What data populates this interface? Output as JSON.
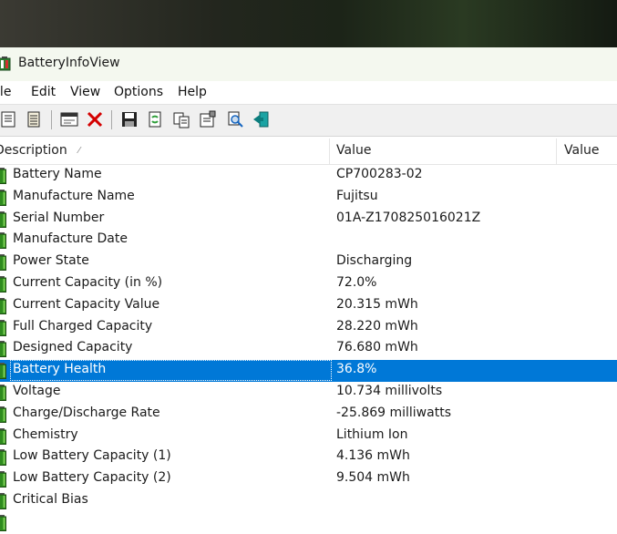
{
  "window": {
    "title": "BatteryInfoView"
  },
  "menu": [
    "File",
    "Edit",
    "View",
    "Options",
    "Help"
  ],
  "toolbar": [
    {
      "icon": "html-report-icon"
    },
    {
      "icon": "text-report-icon"
    },
    {
      "icon": "properties-window-icon"
    },
    {
      "icon": "delete-icon"
    },
    {
      "icon": "save-icon"
    },
    {
      "icon": "refresh-icon"
    },
    {
      "icon": "copy-icon"
    },
    {
      "icon": "properties-icon"
    },
    {
      "icon": "find-icon"
    },
    {
      "icon": "exit-icon"
    }
  ],
  "columns": {
    "description": "Description",
    "value": "Value",
    "value2": "Value"
  },
  "rows": [
    {
      "description": "Battery Name",
      "value": "CP700283-02"
    },
    {
      "description": "Manufacture Name",
      "value": "Fujitsu"
    },
    {
      "description": "Serial Number",
      "value": "01A-Z170825016021Z"
    },
    {
      "description": "Manufacture Date",
      "value": ""
    },
    {
      "description": "Power State",
      "value": "Discharging"
    },
    {
      "description": "Current Capacity (in %)",
      "value": "72.0%"
    },
    {
      "description": "Current Capacity Value",
      "value": "20.315 mWh"
    },
    {
      "description": "Full Charged Capacity",
      "value": "28.220 mWh"
    },
    {
      "description": "Designed Capacity",
      "value": "76.680 mWh"
    },
    {
      "description": "Battery Health",
      "value": "36.8%",
      "selected": true
    },
    {
      "description": "Voltage",
      "value": "10.734 millivolts"
    },
    {
      "description": "Charge/Discharge Rate",
      "value": "-25.869 milliwatts"
    },
    {
      "description": "Chemistry",
      "value": "Lithium Ion"
    },
    {
      "description": "Low Battery Capacity (1)",
      "value": "4.136 mWh"
    },
    {
      "description": "Low Battery Capacity (2)",
      "value": "9.504 mWh"
    },
    {
      "description": "Critical Bias",
      "value": ""
    },
    {
      "description": "",
      "value": ""
    }
  ],
  "colors": {
    "selection": "#0078d7",
    "battery_green": "#2e8b1e"
  }
}
